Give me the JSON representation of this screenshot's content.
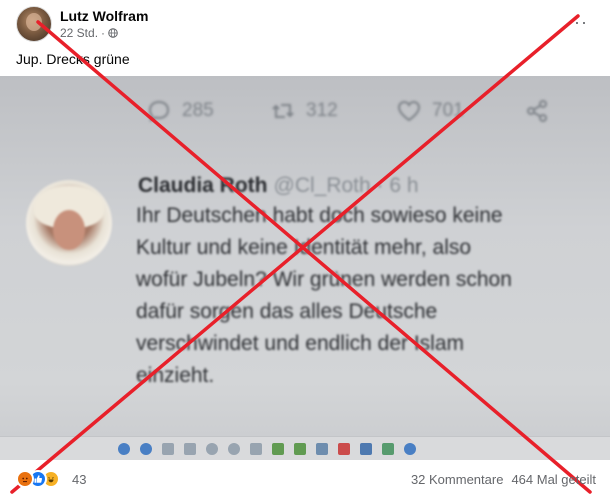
{
  "post": {
    "author": "Lutz Wolfram",
    "time": "22 Std.",
    "separator": "·",
    "text": "Jup. Drecks grüne",
    "more_label": "···"
  },
  "screenshot": {
    "actions": {
      "replies": "285",
      "retweets": "312",
      "likes": "701"
    },
    "tweet": {
      "name": "Claudia Roth",
      "handle": "@Cl_Roth · 6 h",
      "text": "Ihr Deutschen habt doch sowieso keine\nKultur und keine Identität mehr,   also\nwofür Jubeln?  Wir grünen werden schon\ndafür sorgen das alles  Deutsche\nverschwindet und endlich der Islam\neinzieht."
    }
  },
  "footer": {
    "reaction_count": "43",
    "comments": "32 Kommentare",
    "shares": "464 Mal geteilt"
  },
  "colors": {
    "cross": "#e8202a",
    "like_blue": "#1877f2",
    "angry": "#e9710f",
    "haha": "#f7b125"
  },
  "icons": [
    "globe-icon",
    "more-icon",
    "reply-icon",
    "retweet-icon",
    "heart-icon",
    "share-icon",
    "like-reaction-icon",
    "angry-reaction-icon",
    "haha-reaction-icon"
  ]
}
